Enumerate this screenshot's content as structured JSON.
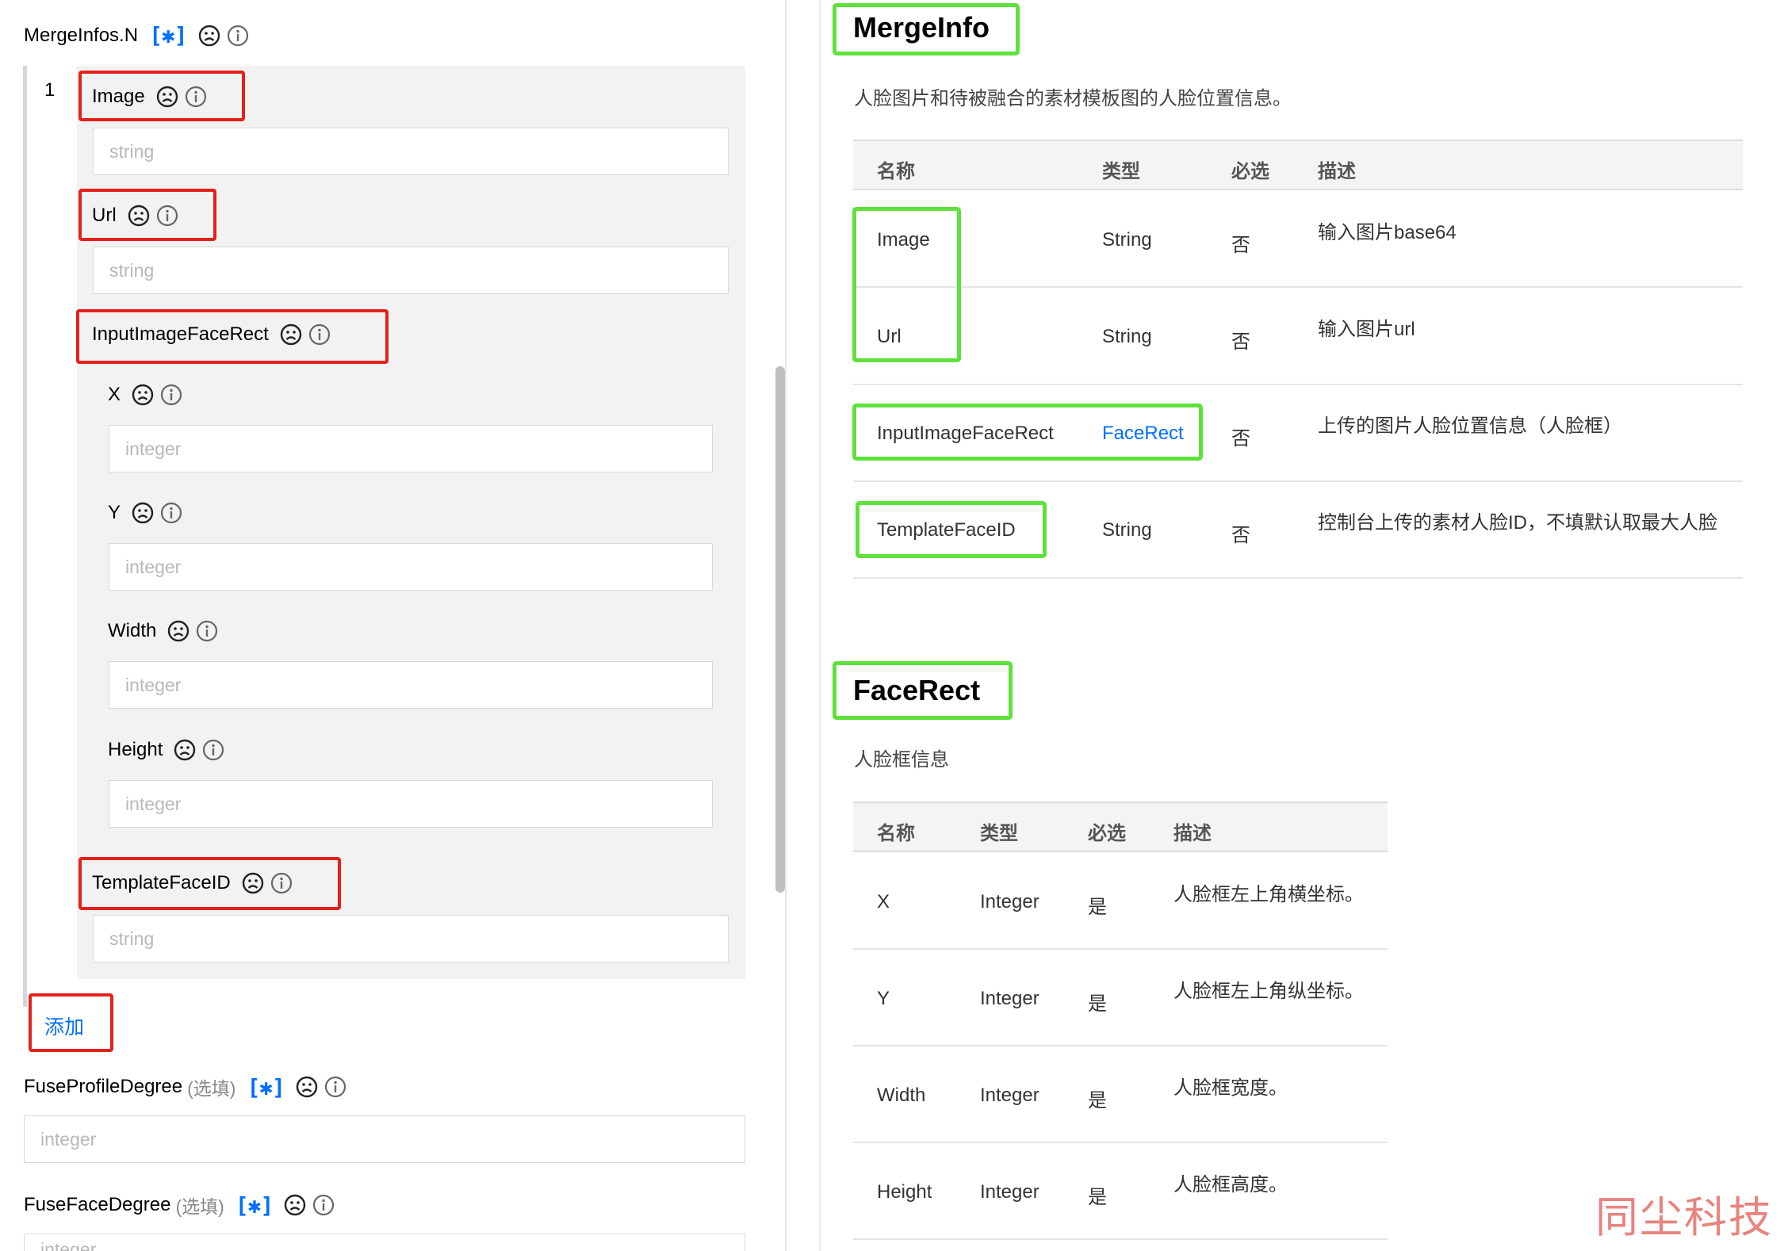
{
  "left": {
    "mergeinfos_label": "MergeInfos.N",
    "item_index": "1",
    "add_link": "添加",
    "fields": {
      "image": {
        "label": "Image",
        "placeholder": "string"
      },
      "url": {
        "label": "Url",
        "placeholder": "string"
      },
      "rect": {
        "label": "InputImageFaceRect"
      },
      "x": {
        "label": "X",
        "placeholder": "integer"
      },
      "y": {
        "label": "Y",
        "placeholder": "integer"
      },
      "width": {
        "label": "Width",
        "placeholder": "integer"
      },
      "height": {
        "label": "Height",
        "placeholder": "integer"
      },
      "template": {
        "label": "TemplateFaceID",
        "placeholder": "string"
      }
    },
    "fuse_profile": {
      "label": "FuseProfileDegree",
      "optional": "(选填)",
      "placeholder": "integer"
    },
    "fuse_face": {
      "label": "FuseFaceDegree",
      "optional": "(选填)",
      "placeholder": "integer"
    },
    "star_text": "[✱]"
  },
  "right": {
    "mergeinfo": {
      "title": "MergeInfo",
      "desc": "人脸图片和待被融合的素材模板图的人脸位置信息。",
      "headers": [
        "名称",
        "类型",
        "必选",
        "描述"
      ],
      "rows": [
        {
          "name": "Image",
          "type": "String",
          "req": "否",
          "desc": "输入图片base64"
        },
        {
          "name": "Url",
          "type": "String",
          "req": "否",
          "desc": "输入图片url"
        },
        {
          "name": "InputImageFaceRect",
          "type": "FaceRect",
          "req": "否",
          "desc": "上传的图片人脸位置信息（人脸框）"
        },
        {
          "name": "TemplateFaceID",
          "type": "String",
          "req": "否",
          "desc": "控制台上传的素材人脸ID，不填默认取最大人脸"
        }
      ]
    },
    "facerect": {
      "title": "FaceRect",
      "desc": "人脸框信息",
      "headers": [
        "名称",
        "类型",
        "必选",
        "描述"
      ],
      "rows": [
        {
          "name": "X",
          "type": "Integer",
          "req": "是",
          "desc": "人脸框左上角横坐标。"
        },
        {
          "name": "Y",
          "type": "Integer",
          "req": "是",
          "desc": "人脸框左上角纵坐标。"
        },
        {
          "name": "Width",
          "type": "Integer",
          "req": "是",
          "desc": "人脸框宽度。"
        },
        {
          "name": "Height",
          "type": "Integer",
          "req": "是",
          "desc": "人脸框高度。"
        }
      ]
    }
  },
  "watermark": "同尘科技",
  "colors": {
    "accent": "#006eff",
    "red_highlight": "#e5201b",
    "green_highlight": "#5fe13c"
  }
}
